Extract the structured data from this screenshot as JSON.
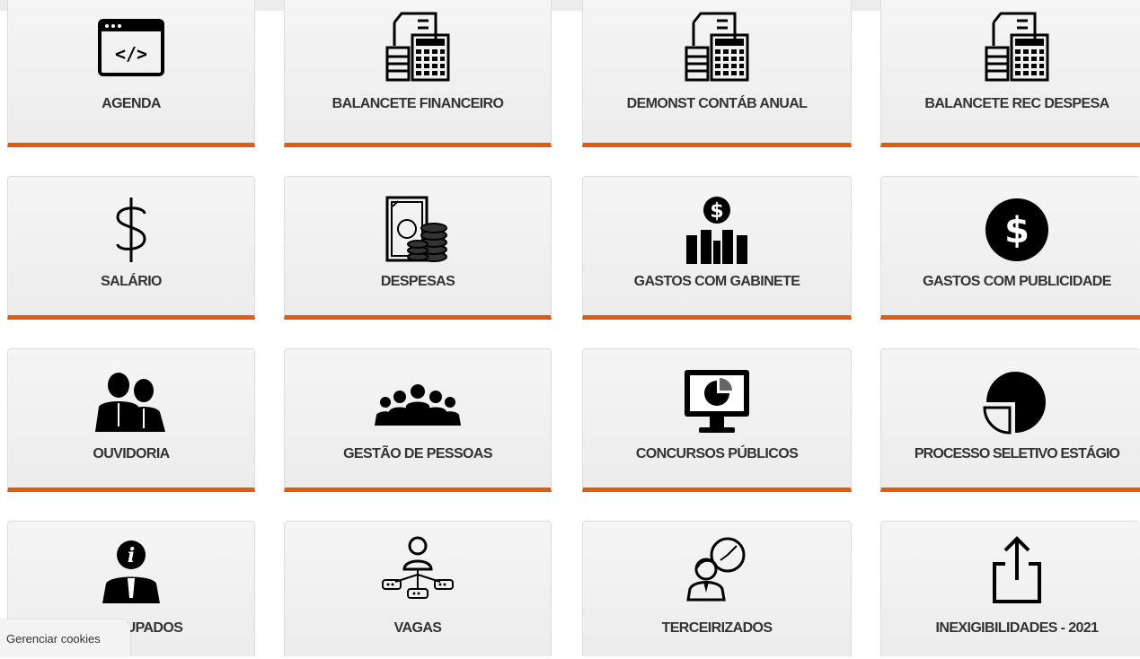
{
  "tiles": [
    {
      "label": "AGENDA",
      "icon": "code-window-icon"
    },
    {
      "label": "BALANCETE FINANCEIRO",
      "icon": "financial-documents-icon"
    },
    {
      "label": "DEMONST CONTÁB ANUAL",
      "icon": "financial-documents-icon"
    },
    {
      "label": "BALANCETE REC DESPESA",
      "icon": "financial-documents-icon"
    },
    {
      "label": "SALÁRIO",
      "icon": "dollar-sign-icon"
    },
    {
      "label": "DESPESAS",
      "icon": "money-coins-icon"
    },
    {
      "label": "GASTOS COM GABINETE",
      "icon": "dollar-bars-icon"
    },
    {
      "label": "GASTOS COM PUBLICIDADE",
      "icon": "dollar-circle-icon"
    },
    {
      "label": "OUVIDORIA",
      "icon": "people-pair-icon"
    },
    {
      "label": "GESTÃO DE PESSOAS",
      "icon": "group-people-icon"
    },
    {
      "label": "CONCURSOS PÚBLICOS",
      "icon": "monitor-chart-icon"
    },
    {
      "label": "PROCESSO SELETIVO ESTÁGIO",
      "icon": "pie-shape-icon"
    },
    {
      "label": "CUPADOS",
      "icon": "info-person-icon"
    },
    {
      "label": "VAGAS",
      "icon": "network-person-icon"
    },
    {
      "label": "TERCEIRIZADOS",
      "icon": "person-clock-icon"
    },
    {
      "label": "INEXIGIBILIDADES - 2021",
      "icon": "share-upload-icon"
    }
  ],
  "cookies_label": "Gerenciar cookies",
  "accent_color": "#e05a12"
}
